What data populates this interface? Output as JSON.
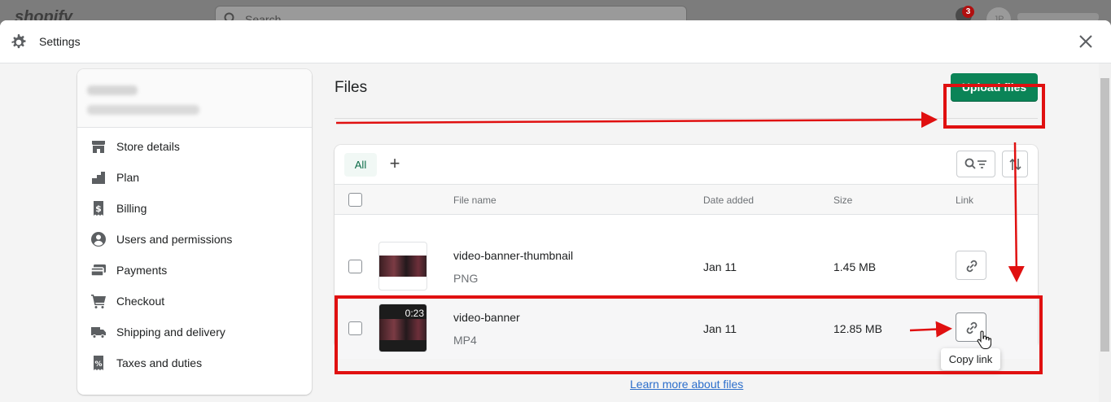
{
  "topbar": {
    "logo": "shopify",
    "search_placeholder": "Search",
    "notification_count": "3",
    "avatar_initials": "JP"
  },
  "modal": {
    "title": "Settings"
  },
  "sidebar": {
    "items": [
      {
        "label": "Store details",
        "icon": "store-icon"
      },
      {
        "label": "Plan",
        "icon": "plan-icon"
      },
      {
        "label": "Billing",
        "icon": "billing-icon"
      },
      {
        "label": "Users and permissions",
        "icon": "user-icon"
      },
      {
        "label": "Payments",
        "icon": "payments-icon"
      },
      {
        "label": "Checkout",
        "icon": "cart-icon"
      },
      {
        "label": "Shipping and delivery",
        "icon": "truck-icon"
      },
      {
        "label": "Taxes and duties",
        "icon": "tax-icon"
      }
    ]
  },
  "files": {
    "title": "Files",
    "upload_label": "Upload files",
    "tab_all": "All",
    "tab_add": "+",
    "columns": {
      "name": "File name",
      "date": "Date added",
      "size": "Size",
      "link": "Link"
    },
    "rows": [
      {
        "name": "video-banner-thumbnail",
        "type": "PNG",
        "date": "Jan 11",
        "size": "1.45 MB",
        "duration": ""
      },
      {
        "name": "video-banner",
        "type": "MP4",
        "date": "Jan 11",
        "size": "12.85 MB",
        "duration": "0:23"
      }
    ],
    "tooltip": "Copy link",
    "learn_more": "Learn more about files"
  },
  "colors": {
    "primary": "#0b8457",
    "annotation": "#e01010",
    "link": "#2c6ecb"
  }
}
